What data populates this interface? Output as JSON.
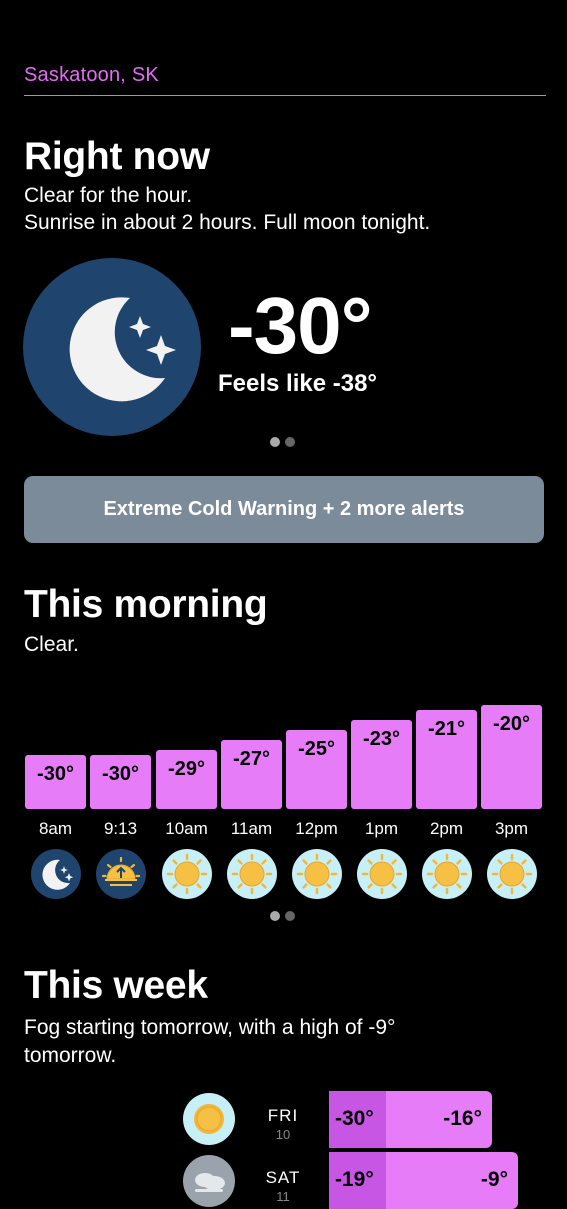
{
  "location": "Saskatoon, SK",
  "now": {
    "title": "Right now",
    "line1": "Clear for the hour.",
    "line2": "Sunrise in about 2 hours. Full moon tonight.",
    "icon": "moon-stars-icon",
    "temp": "-30°",
    "feels": "Feels like -38°"
  },
  "alert": {
    "label": "Extreme Cold Warning + 2 more alerts"
  },
  "morning": {
    "title": "This morning",
    "summary": "Clear.",
    "hours": [
      {
        "label": "8am",
        "temp": "-30°",
        "value": -30,
        "icon": "moon-stars-icon"
      },
      {
        "label": "9:13",
        "temp": "-30°",
        "value": -30,
        "icon": "sunrise-icon"
      },
      {
        "label": "10am",
        "temp": "-29°",
        "value": -29,
        "icon": "sun-icon"
      },
      {
        "label": "11am",
        "temp": "-27°",
        "value": -27,
        "icon": "sun-icon"
      },
      {
        "label": "12pm",
        "temp": "-25°",
        "value": -25,
        "icon": "sun-icon"
      },
      {
        "label": "1pm",
        "temp": "-23°",
        "value": -23,
        "icon": "sun-icon"
      },
      {
        "label": "2pm",
        "temp": "-21°",
        "value": -21,
        "icon": "sun-icon"
      },
      {
        "label": "3pm",
        "temp": "-20°",
        "value": -20,
        "icon": "sun-icon"
      }
    ]
  },
  "week": {
    "title": "This week",
    "summary_line1": "Fog starting tomorrow, with a high of -9°",
    "summary_line2": "tomorrow.",
    "days": [
      {
        "name": "FRI",
        "date": "10",
        "low": "-30°",
        "high": "-16°",
        "icon": "sun-icon"
      },
      {
        "name": "SAT",
        "date": "11",
        "low": "-19°",
        "high": "-9°",
        "icon": "fog-icon"
      }
    ]
  },
  "colors": {
    "accent": "#e67cf7",
    "accent_dark": "#c756e4",
    "moon_bg": "#1f446d",
    "sun": "#f2b73a",
    "sun_bg": "#c6f0f5",
    "alert_bg": "#7c8b99"
  }
}
